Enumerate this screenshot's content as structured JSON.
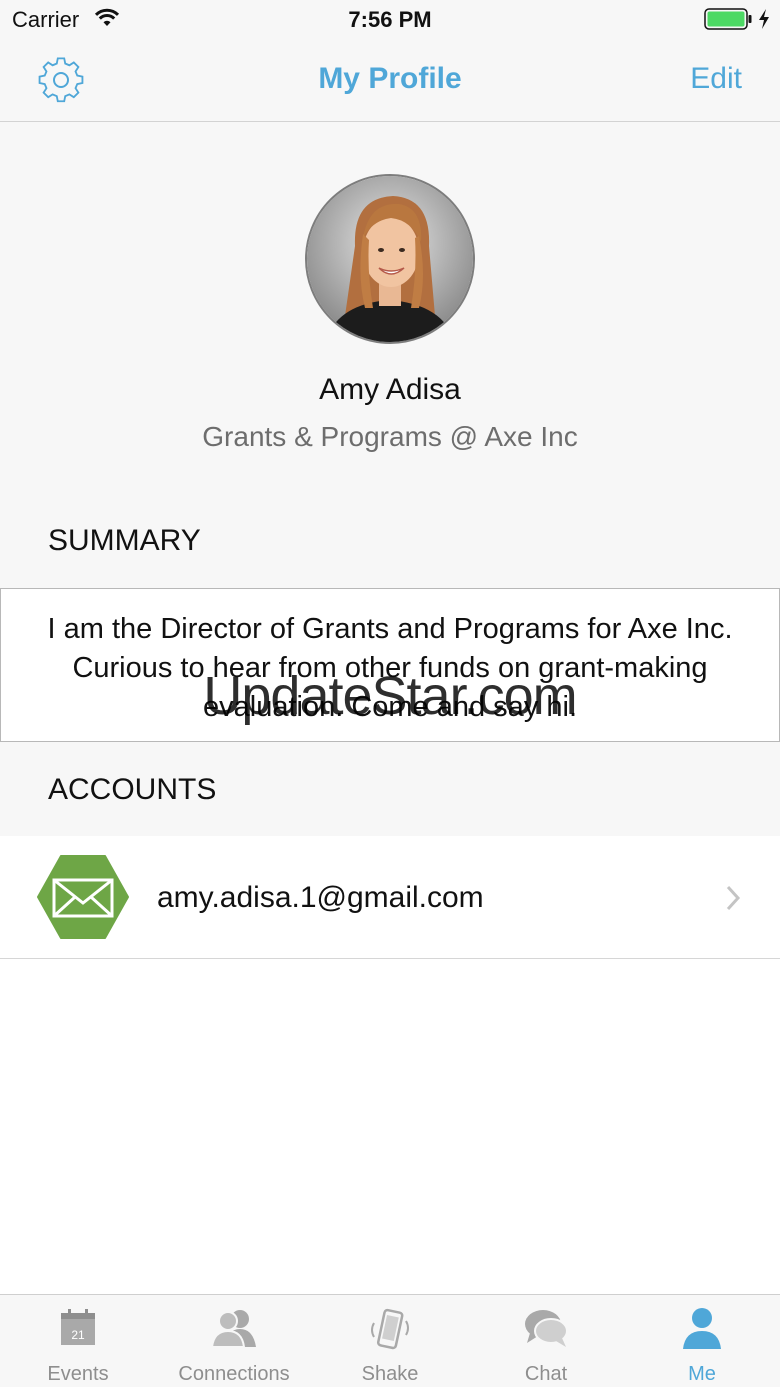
{
  "status_bar": {
    "carrier": "Carrier",
    "time": "7:56 PM"
  },
  "nav": {
    "title": "My Profile",
    "edit_label": "Edit"
  },
  "profile": {
    "name": "Amy Adisa",
    "title": "Grants & Programs @ Axe Inc"
  },
  "summary": {
    "header": "SUMMARY",
    "text": "I am the Director of Grants and Programs for Axe Inc. Curious to hear from other funds on grant-making evaluation. Come and say hi."
  },
  "watermark": "UpdateStar.com",
  "accounts": {
    "header": "ACCOUNTS",
    "items": [
      {
        "email": "amy.adisa.1@gmail.com",
        "icon": "email-icon"
      }
    ]
  },
  "tabs": [
    {
      "label": "Events",
      "icon": "calendar-icon",
      "badge": "21",
      "active": false
    },
    {
      "label": "Connections",
      "icon": "people-icon",
      "active": false
    },
    {
      "label": "Shake",
      "icon": "phone-shake-icon",
      "active": false
    },
    {
      "label": "Chat",
      "icon": "chat-icon",
      "active": false
    },
    {
      "label": "Me",
      "icon": "person-icon",
      "active": true
    }
  ],
  "colors": {
    "accent": "#4fa7d8",
    "email_icon_green": "#6ea646",
    "battery_green": "#4cd964",
    "inactive_tab": "#8e8e8e"
  }
}
